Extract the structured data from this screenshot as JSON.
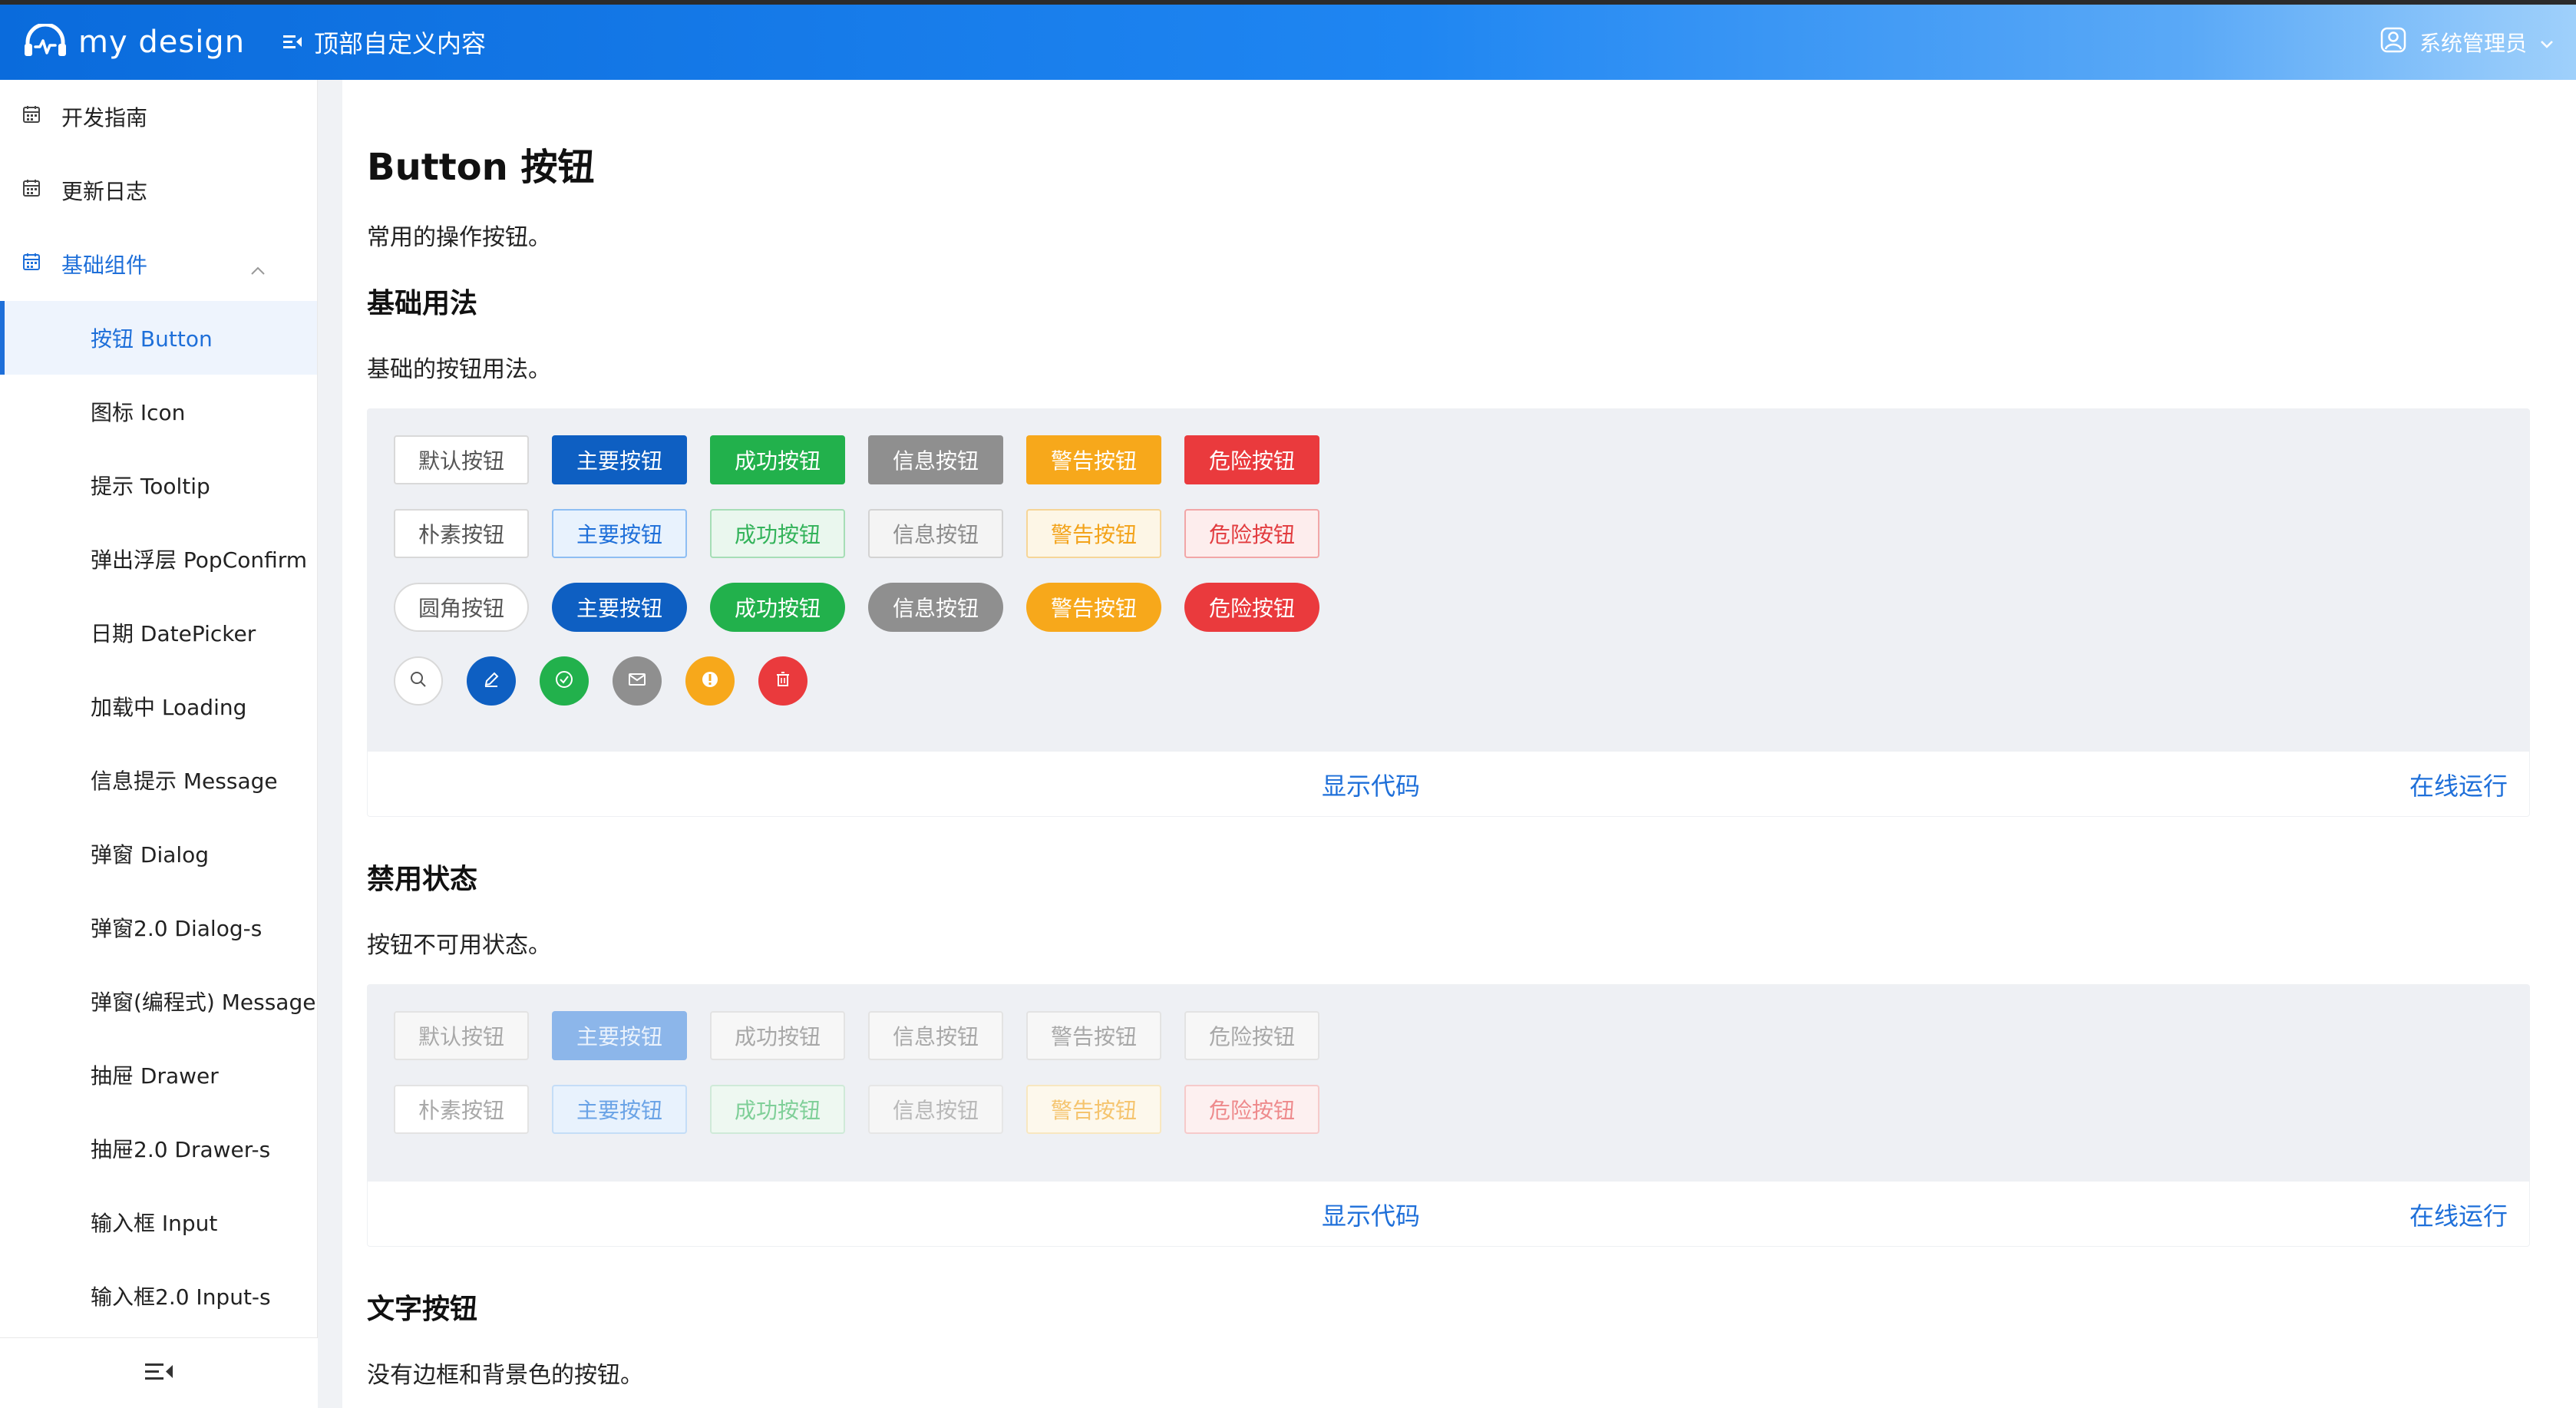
{
  "header": {
    "logo_text": "my design",
    "custom_content": "顶部自定义内容",
    "user_name": "系统管理员"
  },
  "sidebar": {
    "top_items": [
      {
        "label": "开发指南"
      },
      {
        "label": "更新日志"
      }
    ],
    "group": {
      "label": "基础组件",
      "expanded": true
    },
    "sub_items": [
      {
        "label": "按钮 Button",
        "active": true
      },
      {
        "label": "图标 Icon"
      },
      {
        "label": "提示 Tooltip"
      },
      {
        "label": "弹出浮层 PopConfirm"
      },
      {
        "label": "日期 DatePicker"
      },
      {
        "label": "加载中 Loading"
      },
      {
        "label": "信息提示 Message"
      },
      {
        "label": "弹窗 Dialog"
      },
      {
        "label": "弹窗2.0 Dialog-s"
      },
      {
        "label": "弹窗(编程式) MessageBox"
      },
      {
        "label": "抽屉 Drawer"
      },
      {
        "label": "抽屉2.0 Drawer-s"
      },
      {
        "label": "输入框 Input"
      },
      {
        "label": "输入框2.0 Input-s"
      }
    ]
  },
  "main": {
    "title": "Button 按钮",
    "desc": "常用的操作按钮。",
    "sections": [
      {
        "title": "基础用法",
        "desc": "基础的按钮用法。",
        "rows": [
          [
            "默认按钮",
            "主要按钮",
            "成功按钮",
            "信息按钮",
            "警告按钮",
            "危险按钮"
          ],
          [
            "朴素按钮",
            "主要按钮",
            "成功按钮",
            "信息按钮",
            "警告按钮",
            "危险按钮"
          ],
          [
            "圆角按钮",
            "主要按钮",
            "成功按钮",
            "信息按钮",
            "警告按钮",
            "危险按钮"
          ]
        ],
        "icon_buttons": [
          "search-icon",
          "edit-icon",
          "check-icon",
          "message-icon",
          "star-icon",
          "delete-icon"
        ],
        "show_code": "显示代码",
        "run_online": "在线运行"
      },
      {
        "title": "禁用状态",
        "desc": "按钮不可用状态。",
        "rows": [
          [
            "默认按钮",
            "主要按钮",
            "成功按钮",
            "信息按钮",
            "警告按钮",
            "危险按钮"
          ],
          [
            "朴素按钮",
            "主要按钮",
            "成功按钮",
            "信息按钮",
            "警告按钮",
            "危险按钮"
          ]
        ],
        "show_code": "显示代码",
        "run_online": "在线运行"
      },
      {
        "title": "文字按钮",
        "desc": "没有边框和背景色的按钮。"
      }
    ]
  },
  "colors": {
    "primary": "#0e5fc2",
    "success": "#22b14c",
    "info": "#8f8f8f",
    "warning": "#f7a81b",
    "danger": "#ea3a3d"
  }
}
